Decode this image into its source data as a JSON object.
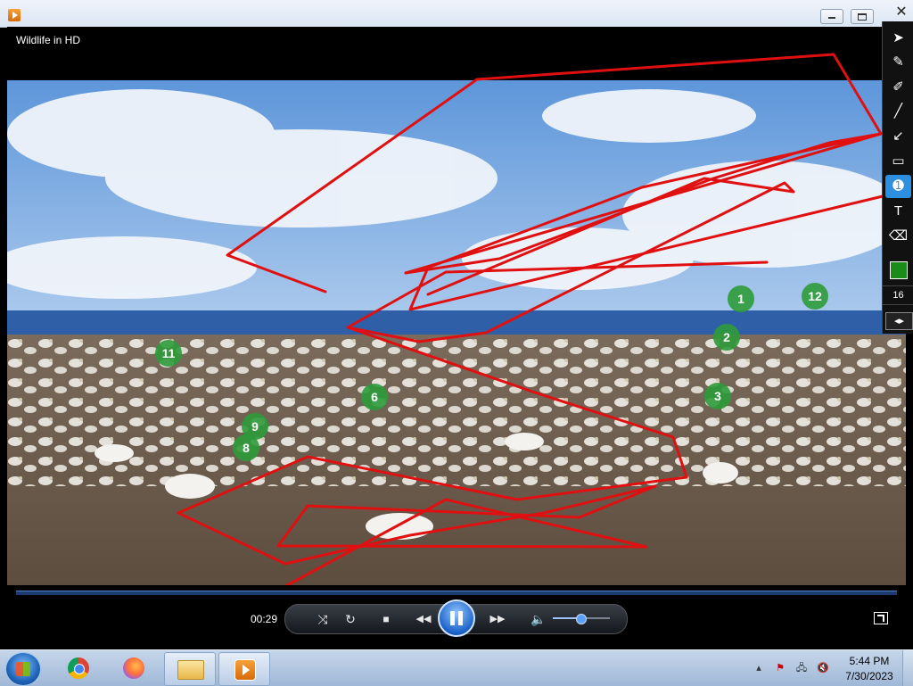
{
  "window": {
    "title": "",
    "close_glyph": "✕"
  },
  "video": {
    "title": "Wildlife in HD"
  },
  "player": {
    "elapsed": "00:29",
    "volume_level": 0.5,
    "controls": {
      "shuffle_icon": "⤨",
      "repeat_icon": "↻",
      "stop_icon": "■",
      "previous_icon": "◀◀",
      "next_icon": "▶▶",
      "volume_icon": "🔈"
    }
  },
  "annotation_toolbar": {
    "tools": [
      {
        "name": "select-tool",
        "glyph": "➤"
      },
      {
        "name": "pencil-tool",
        "glyph": "✎"
      },
      {
        "name": "highlighter-tool",
        "glyph": "✐"
      },
      {
        "name": "line-tool",
        "glyph": "╱"
      },
      {
        "name": "arrow-tool",
        "glyph": "↙"
      },
      {
        "name": "rectangle-tool",
        "glyph": "▭"
      },
      {
        "name": "counter-tool",
        "glyph": "➊"
      },
      {
        "name": "text-tool",
        "glyph": "T"
      },
      {
        "name": "eraser-tool",
        "glyph": "⌫"
      }
    ],
    "active_tool": "counter-tool",
    "color": "#1a8c1a",
    "pen_size": "16",
    "collapse_glyph": "◂▸"
  },
  "annotations": {
    "stroke_color": "#e01010",
    "marker_color": "#2e9b3a",
    "markers": [
      "1",
      "2",
      "3",
      "6",
      "8",
      "9",
      "11",
      "12"
    ]
  },
  "taskbar": {
    "clock_time": "5:44 PM",
    "clock_date": "7/30/2023",
    "apps": [
      "chrome",
      "firefox",
      "explorer",
      "windows-media-player"
    ],
    "tray_icons": [
      "▴",
      "⚑",
      "🖧",
      "🔇"
    ]
  }
}
